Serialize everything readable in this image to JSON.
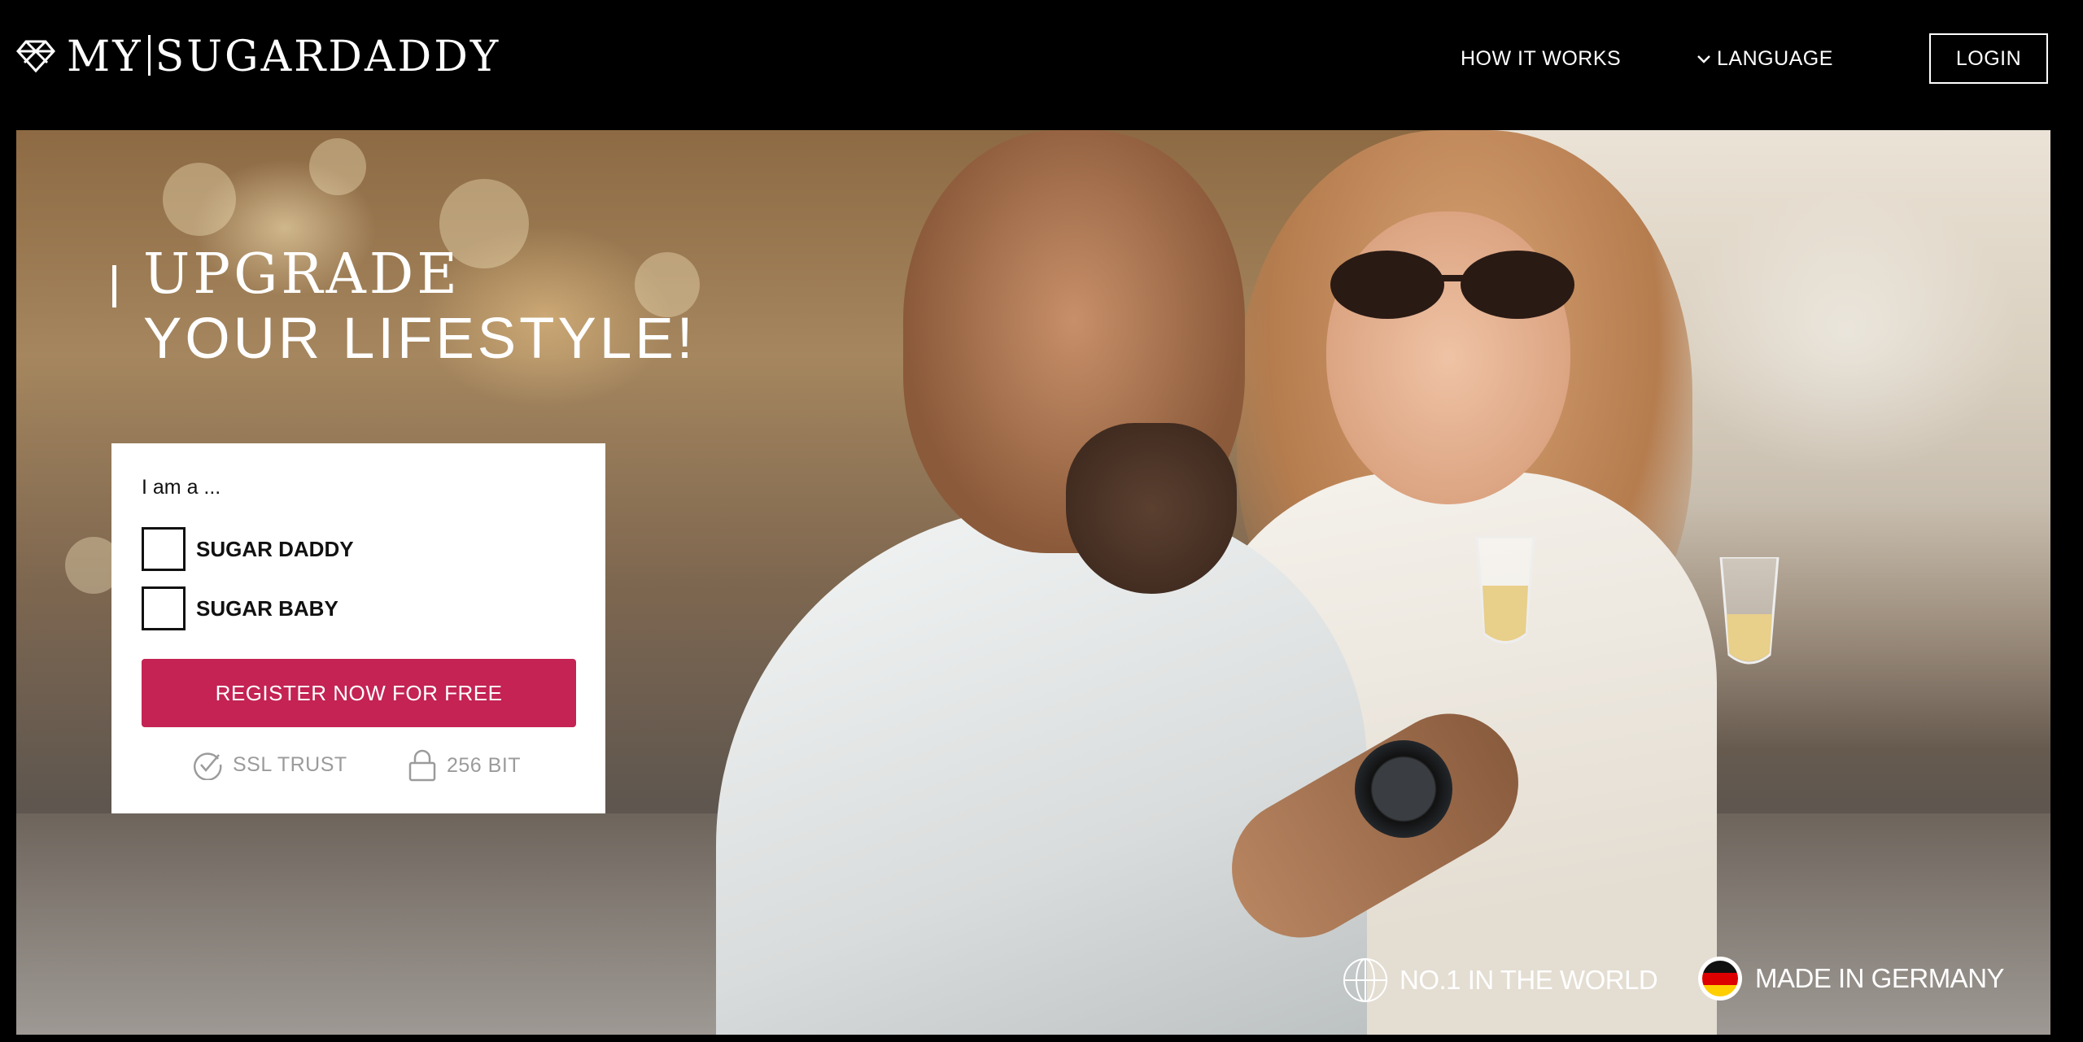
{
  "header": {
    "logo_left": "MY",
    "logo_right": "SUGARDADDY",
    "nav": {
      "how_it_works": "HOW IT WORKS",
      "language": "LANGUAGE",
      "login": "LOGIN"
    }
  },
  "hero": {
    "headline_line1": "UPGRADE",
    "headline_line2": "YOUR LIFESTYLE!"
  },
  "registration": {
    "prompt": "I am a ...",
    "options": [
      {
        "label": "SUGAR DADDY",
        "checked": false
      },
      {
        "label": "SUGAR BABY",
        "checked": false
      }
    ],
    "register_label": "REGISTER NOW FOR FREE",
    "trust_ssl": "SSL TRUST",
    "trust_bit": "256 BIT"
  },
  "badges": {
    "world": "NO.1 IN THE WORLD",
    "germany": "MADE IN GERMANY"
  },
  "colors": {
    "accent": "#c42354",
    "background": "#000000",
    "muted": "#9b9b9b"
  },
  "icons": [
    "logo-diamond-icon",
    "chevron-down-icon",
    "check-circle-icon",
    "lock-icon",
    "globe-icon",
    "germany-flag-icon"
  ]
}
